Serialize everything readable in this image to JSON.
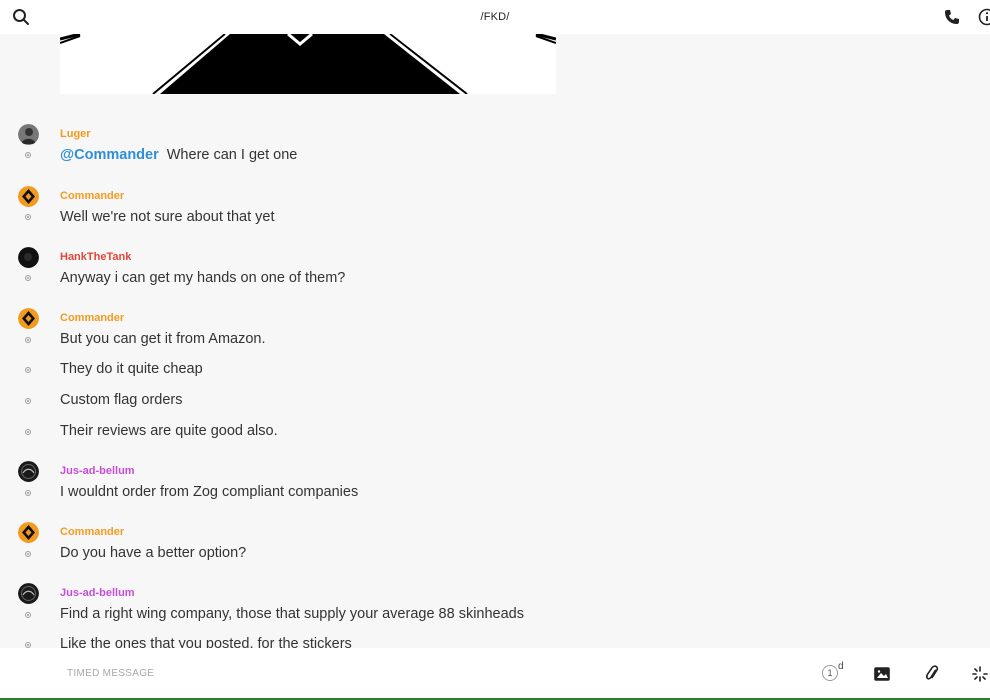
{
  "header": {
    "title": "/FKD/"
  },
  "colors": {
    "commander": "#f29b1e",
    "luger": "#f29b1e",
    "hank": "#e0473a",
    "jus": "#c34fd8",
    "mention": "#2e8fd6"
  },
  "messages": [
    {
      "sender": "Luger",
      "lines": [
        {
          "mention": "@Commander",
          "text": "Where can I get one"
        }
      ]
    },
    {
      "sender": "Commander",
      "lines": [
        {
          "text": "Well we're not sure about that yet"
        }
      ]
    },
    {
      "sender": "HankTheTank",
      "lines": [
        {
          "text": "Anyway i can get my hands on one of them?"
        }
      ]
    },
    {
      "sender": "Commander",
      "lines": [
        {
          "text": "But you can get it from Amazon."
        },
        {
          "text": "They do it quite cheap"
        },
        {
          "text": "Custom flag orders"
        },
        {
          "text": "Their reviews are quite good also."
        }
      ]
    },
    {
      "sender": "Jus-ad-bellum",
      "lines": [
        {
          "text": "I wouldnt order from Zog compliant companies"
        }
      ]
    },
    {
      "sender": "Commander",
      "lines": [
        {
          "text": "Do you have a better option?"
        }
      ]
    },
    {
      "sender": "Jus-ad-bellum",
      "lines": [
        {
          "text": "Find a right wing company, those that supply your average 88 skinheads"
        },
        {
          "text": "Like the ones that you posted, for the stickers"
        }
      ]
    }
  ],
  "composer": {
    "placeholder": "TIMED MESSAGE",
    "timer_value": "1",
    "timer_unit": "d"
  }
}
